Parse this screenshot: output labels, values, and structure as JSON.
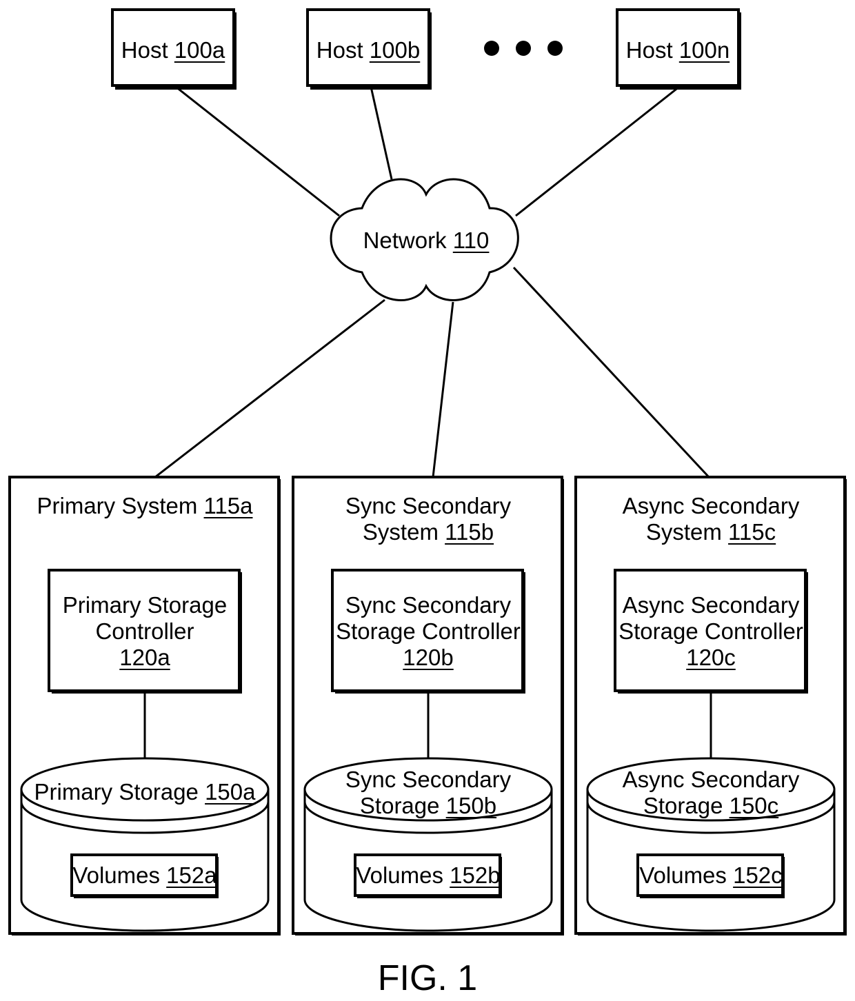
{
  "hosts": [
    {
      "name": "Host",
      "ref": "100a"
    },
    {
      "name": "Host",
      "ref": "100b"
    },
    {
      "name": "Host",
      "ref": "100n"
    }
  ],
  "ellipsis": "• • •",
  "network": {
    "name": "Network",
    "ref": "110"
  },
  "systems": [
    {
      "title_lines": [
        "Primary System"
      ],
      "ref": "115a",
      "controller_lines": [
        "Primary Storage",
        "Controller"
      ],
      "controller_ref": "120a",
      "storage_lines": [
        "Primary Storage"
      ],
      "storage_ref": "150a",
      "volumes": "Volumes",
      "volumes_ref": "152a"
    },
    {
      "title_lines": [
        "Sync Secondary",
        "System"
      ],
      "ref": "115b",
      "controller_lines": [
        "Sync Secondary",
        "Storage Controller"
      ],
      "controller_ref": "120b",
      "storage_lines": [
        "Sync Secondary",
        "Storage"
      ],
      "storage_ref": "150b",
      "volumes": "Volumes",
      "volumes_ref": "152b"
    },
    {
      "title_lines": [
        "Async Secondary",
        "System"
      ],
      "ref": "115c",
      "controller_lines": [
        "Async Secondary",
        "Storage Controller"
      ],
      "controller_ref": "120c",
      "storage_lines": [
        "Async Secondary",
        "Storage"
      ],
      "storage_ref": "150c",
      "volumes": "Volumes",
      "volumes_ref": "152c"
    }
  ],
  "caption": "FIG. 1"
}
